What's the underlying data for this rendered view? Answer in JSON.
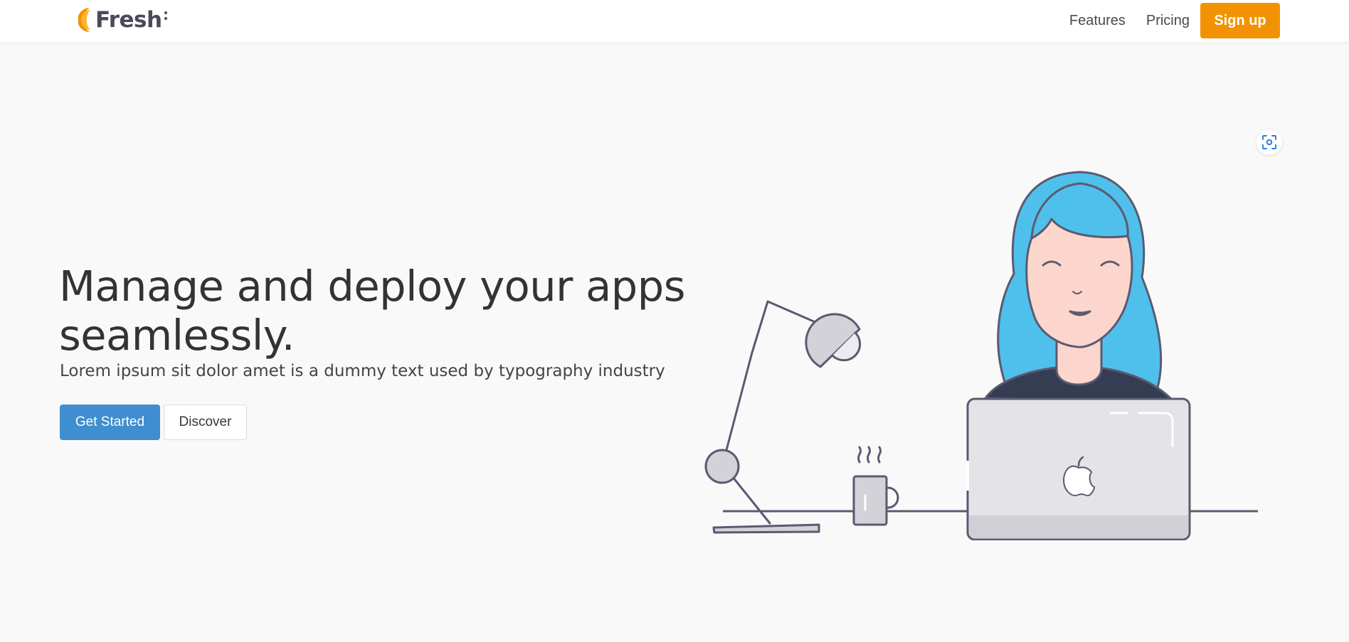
{
  "navbar": {
    "logo_text": "Fresh",
    "links": [
      "Features",
      "Pricing"
    ],
    "signup_label": "Sign up"
  },
  "hero": {
    "title_line1": "Manage and deploy your apps",
    "title_line2": "seamlessly.",
    "subtitle": "Lorem ipsum sit dolor amet is a dummy text used by typography industry",
    "primary_button": "Get Started",
    "secondary_button": "Discover"
  },
  "icons": {
    "logo": "fresh-logo-icon",
    "scan": "scan-icon",
    "illustration": "woman-at-laptop-illustration"
  },
  "colors": {
    "accent_orange": "#f39200",
    "primary_blue": "#3e8ed0",
    "hair_blue": "#4fc0eb",
    "skin": "#fcd6cc",
    "outline": "#5a5a72",
    "laptop_gray": "#e4e4e8"
  }
}
